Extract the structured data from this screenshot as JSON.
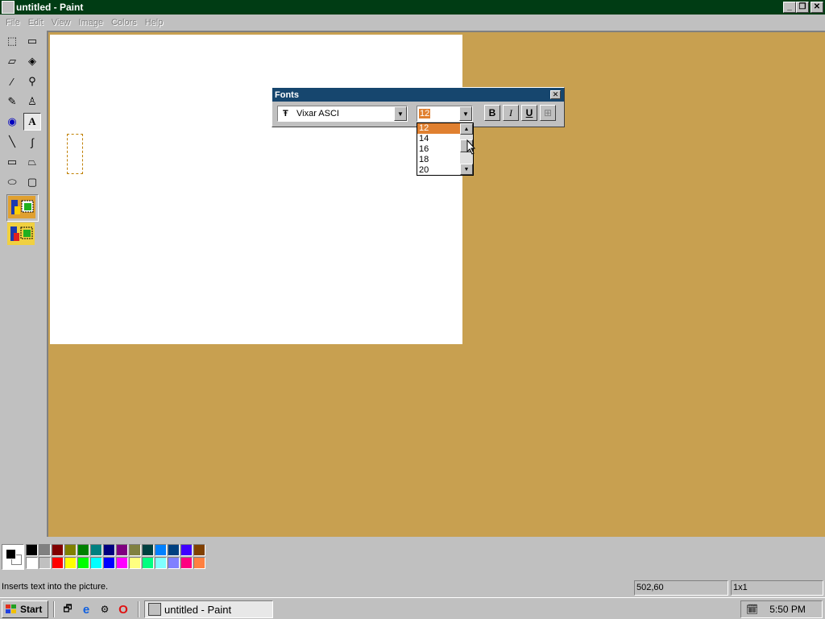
{
  "window": {
    "title": "untitled - Paint",
    "min": "_",
    "max": "❐",
    "close": "✕"
  },
  "menu": [
    "File",
    "Edit",
    "View",
    "Image",
    "Colors",
    "Help"
  ],
  "tools": [
    {
      "name": "free-select",
      "glyph": "⬚"
    },
    {
      "name": "select",
      "glyph": "▭"
    },
    {
      "name": "eraser",
      "glyph": "▱"
    },
    {
      "name": "fill",
      "glyph": "◈"
    },
    {
      "name": "pick-color",
      "glyph": "⁄"
    },
    {
      "name": "magnifier",
      "glyph": "⚲"
    },
    {
      "name": "pencil",
      "glyph": "✎"
    },
    {
      "name": "brush",
      "glyph": "♙"
    },
    {
      "name": "airbrush",
      "glyph": "◉"
    },
    {
      "name": "text",
      "glyph": "A"
    },
    {
      "name": "line",
      "glyph": "╲"
    },
    {
      "name": "curve",
      "glyph": "∫"
    },
    {
      "name": "rectangle",
      "glyph": "▭"
    },
    {
      "name": "polygon",
      "glyph": "⏢"
    },
    {
      "name": "ellipse",
      "glyph": "⬭"
    },
    {
      "name": "rounded-rectangle",
      "glyph": "▢"
    }
  ],
  "fonts_toolbar": {
    "title": "Fonts",
    "font_icon": "Ŧ",
    "font_name": "Vixar ASCI",
    "font_size": "12",
    "bold": "B",
    "italic": "I",
    "underline": "U",
    "vertical": "⊞",
    "size_options": [
      "12",
      "14",
      "16",
      "18",
      "20"
    ]
  },
  "palette": {
    "top": [
      "#000000",
      "#808080",
      "#800000",
      "#808000",
      "#008000",
      "#008080",
      "#000080",
      "#800080",
      "#808040",
      "#004040",
      "#0080ff",
      "#004080",
      "#4000ff",
      "#804000"
    ],
    "bottom": [
      "#ffffff",
      "#c0c0c0",
      "#ff0000",
      "#ffff00",
      "#00ff00",
      "#00ffff",
      "#0000ff",
      "#ff00ff",
      "#ffff80",
      "#00ff80",
      "#80ffff",
      "#8080ff",
      "#ff0080",
      "#ff8040"
    ]
  },
  "status": {
    "hint": "Inserts text into the picture.",
    "coords": "502,60",
    "size": "1x1"
  },
  "taskbar": {
    "start": "Start",
    "task": "untitled - Paint",
    "clock": "5:50 PM"
  }
}
